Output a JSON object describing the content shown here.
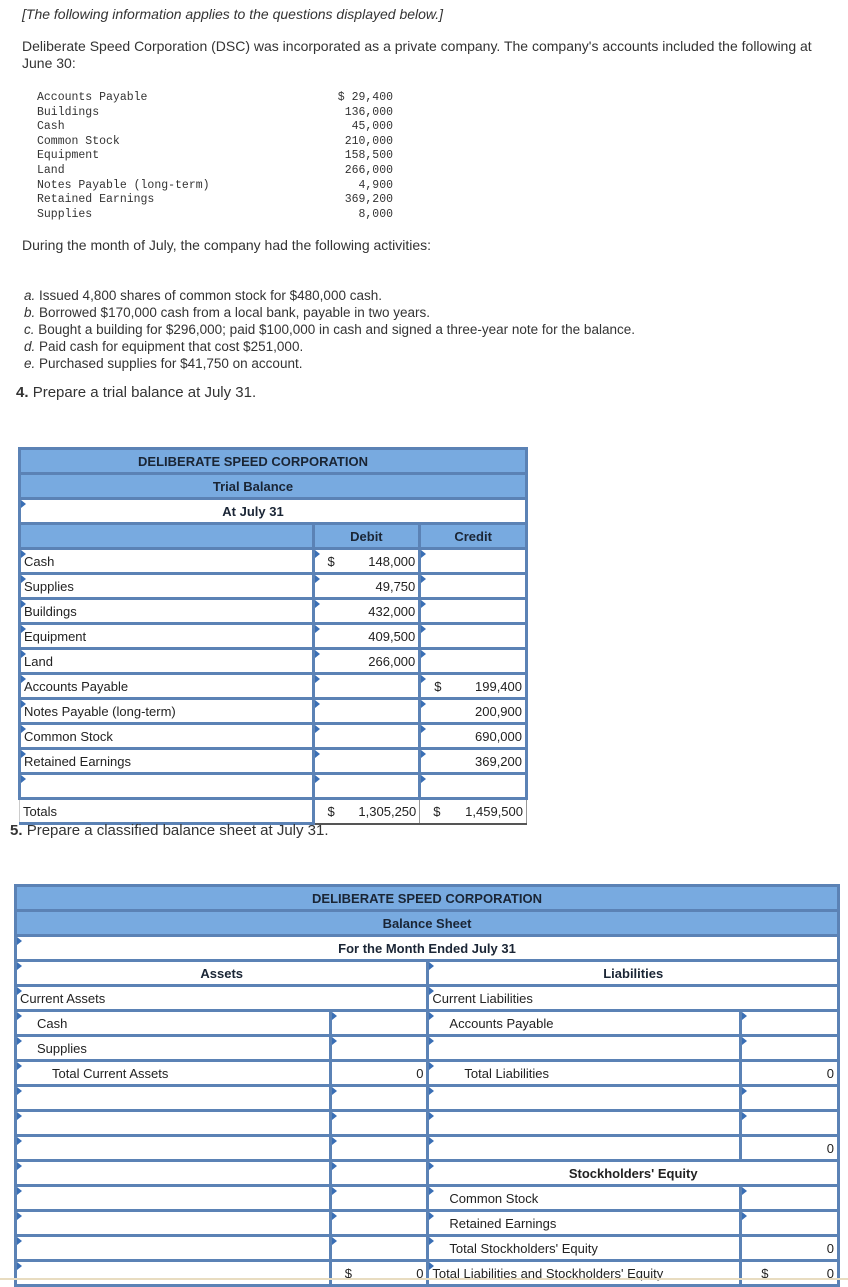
{
  "intro": {
    "note": "[The following information applies to the questions displayed below.]",
    "paragraph": "Deliberate Speed Corporation (DSC) was incorporated as a private company. The company's accounts included the following at June 30:"
  },
  "june_accounts": [
    {
      "name": "Accounts Payable",
      "value": "$ 29,400"
    },
    {
      "name": "Buildings",
      "value": "136,000"
    },
    {
      "name": "Cash",
      "value": "45,000"
    },
    {
      "name": "Common Stock",
      "value": "210,000"
    },
    {
      "name": "Equipment",
      "value": "158,500"
    },
    {
      "name": "Land",
      "value": "266,000"
    },
    {
      "name": "Notes Payable (long-term)",
      "value": "4,900"
    },
    {
      "name": "Retained Earnings",
      "value": "369,200"
    },
    {
      "name": "Supplies",
      "value": "8,000"
    }
  ],
  "during_text": "During the month of July, the company had the following activities:",
  "activities": [
    {
      "letter": "a.",
      "text": "Issued 4,800 shares of common stock for $480,000 cash."
    },
    {
      "letter": "b.",
      "text": "Borrowed $170,000 cash from a local bank, payable in two years."
    },
    {
      "letter": "c.",
      "text": "Bought a building for $296,000; paid $100,000 in cash and signed a three-year note for the balance."
    },
    {
      "letter": "d.",
      "text": "Paid cash for equipment that cost $251,000."
    },
    {
      "letter": "e.",
      "text": "Purchased supplies for $41,750 on account."
    }
  ],
  "question4": {
    "num": "4.",
    "text": "Prepare a trial balance at July 31."
  },
  "trial_balance": {
    "company": "DELIBERATE SPEED CORPORATION",
    "title": "Trial Balance",
    "date": "At July 31",
    "debit_header": "Debit",
    "credit_header": "Credit",
    "rows": [
      {
        "account": "Cash",
        "debit_sign": "$",
        "debit": "148,000",
        "credit_sign": "",
        "credit": ""
      },
      {
        "account": "Supplies",
        "debit_sign": "",
        "debit": "49,750",
        "credit_sign": "",
        "credit": ""
      },
      {
        "account": "Buildings",
        "debit_sign": "",
        "debit": "432,000",
        "credit_sign": "",
        "credit": ""
      },
      {
        "account": "Equipment",
        "debit_sign": "",
        "debit": "409,500",
        "credit_sign": "",
        "credit": ""
      },
      {
        "account": "Land",
        "debit_sign": "",
        "debit": "266,000",
        "credit_sign": "",
        "credit": ""
      },
      {
        "account": "Accounts Payable",
        "debit_sign": "",
        "debit": "",
        "credit_sign": "$",
        "credit": "199,400"
      },
      {
        "account": "Notes Payable (long-term)",
        "debit_sign": "",
        "debit": "",
        "credit_sign": "",
        "credit": "200,900"
      },
      {
        "account": "Common Stock",
        "debit_sign": "",
        "debit": "",
        "credit_sign": "",
        "credit": "690,000"
      },
      {
        "account": "Retained Earnings",
        "debit_sign": "",
        "debit": "",
        "credit_sign": "",
        "credit": "369,200"
      },
      {
        "account": "",
        "debit_sign": "",
        "debit": "",
        "credit_sign": "",
        "credit": ""
      }
    ],
    "totals": {
      "label": "Totals",
      "debit_sign": "$",
      "debit": "1,305,250",
      "credit_sign": "$",
      "credit": "1,459,500"
    }
  },
  "question5": {
    "num": "5.",
    "text": "Prepare a classified balance sheet at July 31."
  },
  "balance_sheet": {
    "company": "DELIBERATE SPEED CORPORATION",
    "title": "Balance Sheet",
    "period": "For the Month Ended July 31",
    "assets_header": "Assets",
    "liabilities_header": "Liabilities",
    "current_assets_label": "Current Assets",
    "current_liabilities_label": "Current Liabilities",
    "cash_label": "Cash",
    "supplies_label": "Supplies",
    "total_current_assets_label": "Total Current Assets",
    "total_current_assets_value": "0",
    "accounts_payable_label": "Accounts Payable",
    "total_liabilities_label": "Total Liabilities",
    "total_liabilities_value": "0",
    "blank_total_value": "0",
    "equity_header": "Stockholders' Equity",
    "common_stock_label": "Common Stock",
    "retained_earnings_label": "Retained Earnings",
    "total_equity_label": "Total Stockholders' Equity",
    "total_equity_value": "0",
    "total_assets_sign": "$",
    "total_assets_value": "0",
    "total_le_label": "Total Liabilities and Stockholders' Equity",
    "total_le_sign": "$",
    "total_le_value": "0"
  }
}
